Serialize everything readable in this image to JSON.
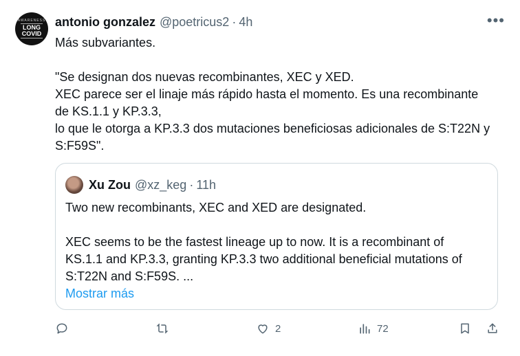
{
  "author": {
    "avatar_text": [
      "LONG",
      "COVID"
    ],
    "avatar_ring": "AWARENESS",
    "name": "antonio gonzalez",
    "handle": "@poetricus2",
    "time": "4h"
  },
  "tweet": {
    "line1": "Más subvariantes.",
    "line2": "\"Se designan dos nuevas recombinantes, XEC y XED.",
    "line3": "XEC parece ser el linaje más rápido hasta el momento. Es una recombinante",
    "line4": "de KS.1.1 y KP.3.3,",
    "line5": "lo que le otorga a KP.3.3 dos mutaciones beneficiosas adicionales de S:T22N y",
    "line6": "S:F59S\"."
  },
  "quote": {
    "name": "Xu Zou",
    "handle": "@xz_keg",
    "time": "11h",
    "line1": "Two new recombinants, XEC and XED are designated.",
    "line2": "XEC seems to be the fastest lineage up to now. It is a recombinant of",
    "line3": "KS.1.1 and KP.3.3, granting KP.3.3 two additional beneficial mutations of",
    "line4": "S:T22N and S:F59S. ...",
    "show_more": "Mostrar más"
  },
  "actions": {
    "replies": "",
    "reposts": "",
    "likes": "2",
    "views": "72"
  },
  "colors": {
    "text": "#0f1419",
    "muted": "#536471",
    "link": "#1d9bf0",
    "border": "#cfd9de"
  },
  "separator": "·"
}
